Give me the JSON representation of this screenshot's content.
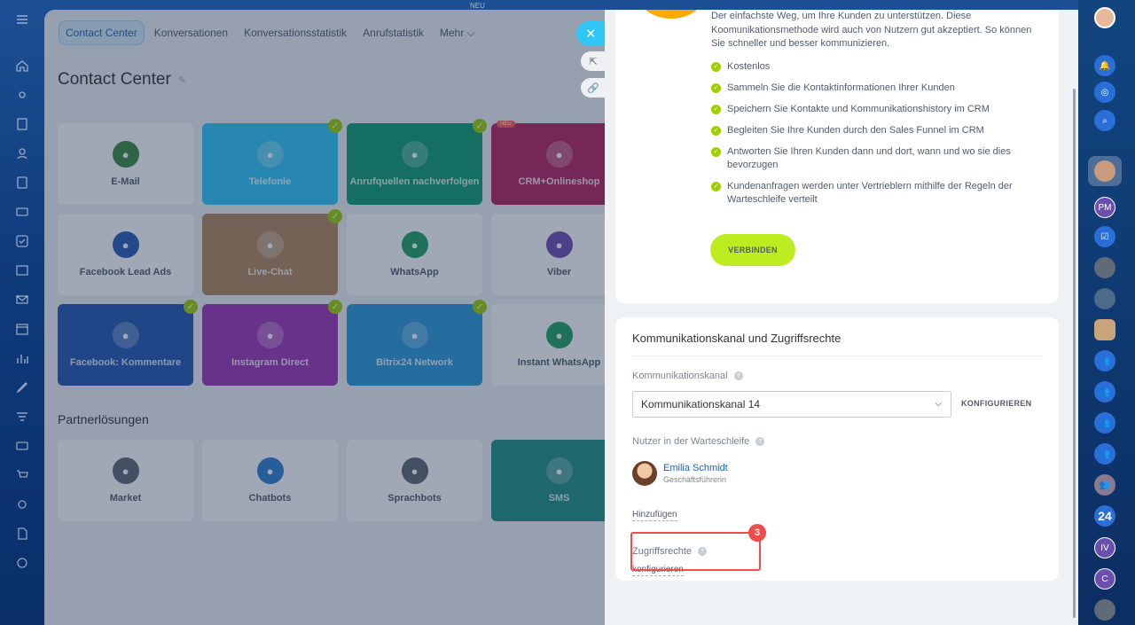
{
  "top_bar": {
    "label": "NEU"
  },
  "workspace": {
    "tabs": [
      {
        "label": "Contact Center",
        "active": true
      },
      {
        "label": "Konversationen",
        "active": false
      },
      {
        "label": "Konversationsstatistik",
        "active": false
      },
      {
        "label": "Anrufstatistik",
        "active": false
      },
      {
        "label": "Mehr ⌵",
        "active": false
      }
    ],
    "title": "Contact Center",
    "tiles": [
      {
        "name": "E-Mail",
        "icon": "envelope-icon",
        "bg": "#ffffff",
        "icon_bg": "#3b8a3e",
        "checked": false
      },
      {
        "name": "Telefonie",
        "icon": "phone-icon",
        "bg": "#2fc6f6",
        "icon_bg": "rgba(255,255,255,0.25)",
        "checked": true
      },
      {
        "name": "Anrufquellen nachverfolgen",
        "icon": "phone-track-icon",
        "bg": "#0f9b6f",
        "icon_bg": "rgba(255,255,255,0.25)",
        "checked": true
      },
      {
        "name": "CRM+Onlineshop",
        "icon": "shop-icon",
        "bg": "#b5245d",
        "icon_bg": "rgba(255,255,255,0.25)",
        "checked": false,
        "badge": "NEU"
      },
      {
        "name": "Facebook Lead Ads",
        "icon": "facebook-lead-icon",
        "bg": "#ffffff",
        "icon_bg": "#2a5bb4",
        "checked": false
      },
      {
        "name": "Live-Chat",
        "icon": "chat-icon",
        "bg": "#b2875a",
        "icon_bg": "rgba(255,255,255,0.25)",
        "checked": true
      },
      {
        "name": "WhatsApp",
        "icon": "whatsapp-icon",
        "bg": "#ffffff",
        "icon_bg": "#21a063",
        "checked": false
      },
      {
        "name": "Viber",
        "icon": "viber-icon",
        "bg": "#ffffff",
        "icon_bg": "#6f4fb3",
        "checked": false
      },
      {
        "name": "Facebook: Kommentare",
        "icon": "facebook-comments-icon",
        "bg": "#2457b0",
        "icon_bg": "rgba(255,255,255,0.25)",
        "checked": true
      },
      {
        "name": "Instagram Direct",
        "icon": "instagram-icon",
        "bg": "#a035b6",
        "icon_bg": "rgba(255,255,255,0.25)",
        "checked": true
      },
      {
        "name": "Bitrix24 Network",
        "icon": "cloud-icon",
        "bg": "#2b98d9",
        "icon_bg": "rgba(255,255,255,0.25)",
        "checked": true
      },
      {
        "name": "Instant WhatsApp",
        "icon": "whatsapp-icon",
        "bg": "#ffffff",
        "icon_bg": "#21a063",
        "checked": false
      }
    ],
    "partner_title": "Partnerlösungen",
    "partner_tiles": [
      {
        "name": "Market",
        "icon": "market-icon",
        "bg": "#ffffff",
        "icon_bg": "#606770"
      },
      {
        "name": "Chatbots",
        "icon": "chatbot-icon",
        "bg": "#ffffff",
        "icon_bg": "#2f80d1"
      },
      {
        "name": "Sprachbots",
        "icon": "microphone-icon",
        "bg": "#ffffff",
        "icon_bg": "#606770"
      },
      {
        "name": "SMS",
        "icon": "sms-icon",
        "bg": "#1f8f83",
        "icon_bg": "rgba(255,255,255,0.25)"
      }
    ]
  },
  "panel": {
    "intro": "Der einfachste Weg, um Ihre Kunden zu unterstützen. Diese Koomunikationsmethode wird auch von Nutzern gut akzeptiert. So können Sie schneller und besser kommunizieren.",
    "bullets": [
      "Kostenlos",
      "Sammeln Sie die Kontaktinformationen Ihrer Kunden",
      "Speichern Sie Kontakte und Kommunikationshistory im CRM",
      "Begleiten Sie Ihre Kunden durch den Sales Funnel im CRM",
      "Antworten Sie Ihren Kunden dann und dort, wann und wo sie dies bevorzugen",
      "Kundenanfragen werden unter Vertrieblern mithilfe der Regeln der Warteschleife verteilt"
    ],
    "connect_label": "VERBINDEN",
    "section_title": "Kommunikationskanal und Zugriffsrechte",
    "channel_label": "Kommunikationskanal",
    "channel_value": "Kommunikationskanal 14",
    "configure_label": "KONFIGURIEREN",
    "queue_label": "Nutzer in der Warteschleife",
    "user": {
      "name": "Emilia Schmidt",
      "role": "Geschäftsführerin"
    },
    "add_label": "Hinzufügen",
    "access_label": "Zugriffsrechte",
    "access_link": "konfigurieren",
    "step_badge": "3"
  },
  "right_rail": {
    "counter": "24",
    "avatar_initials": "PM",
    "avatar_initials_2": "IV",
    "avatar_initials_3": "C"
  },
  "colors": {
    "accent": "#2fc6f6",
    "check": "#9dcf00",
    "connect": "#bbed21",
    "highlight": "#ef4c4c"
  }
}
